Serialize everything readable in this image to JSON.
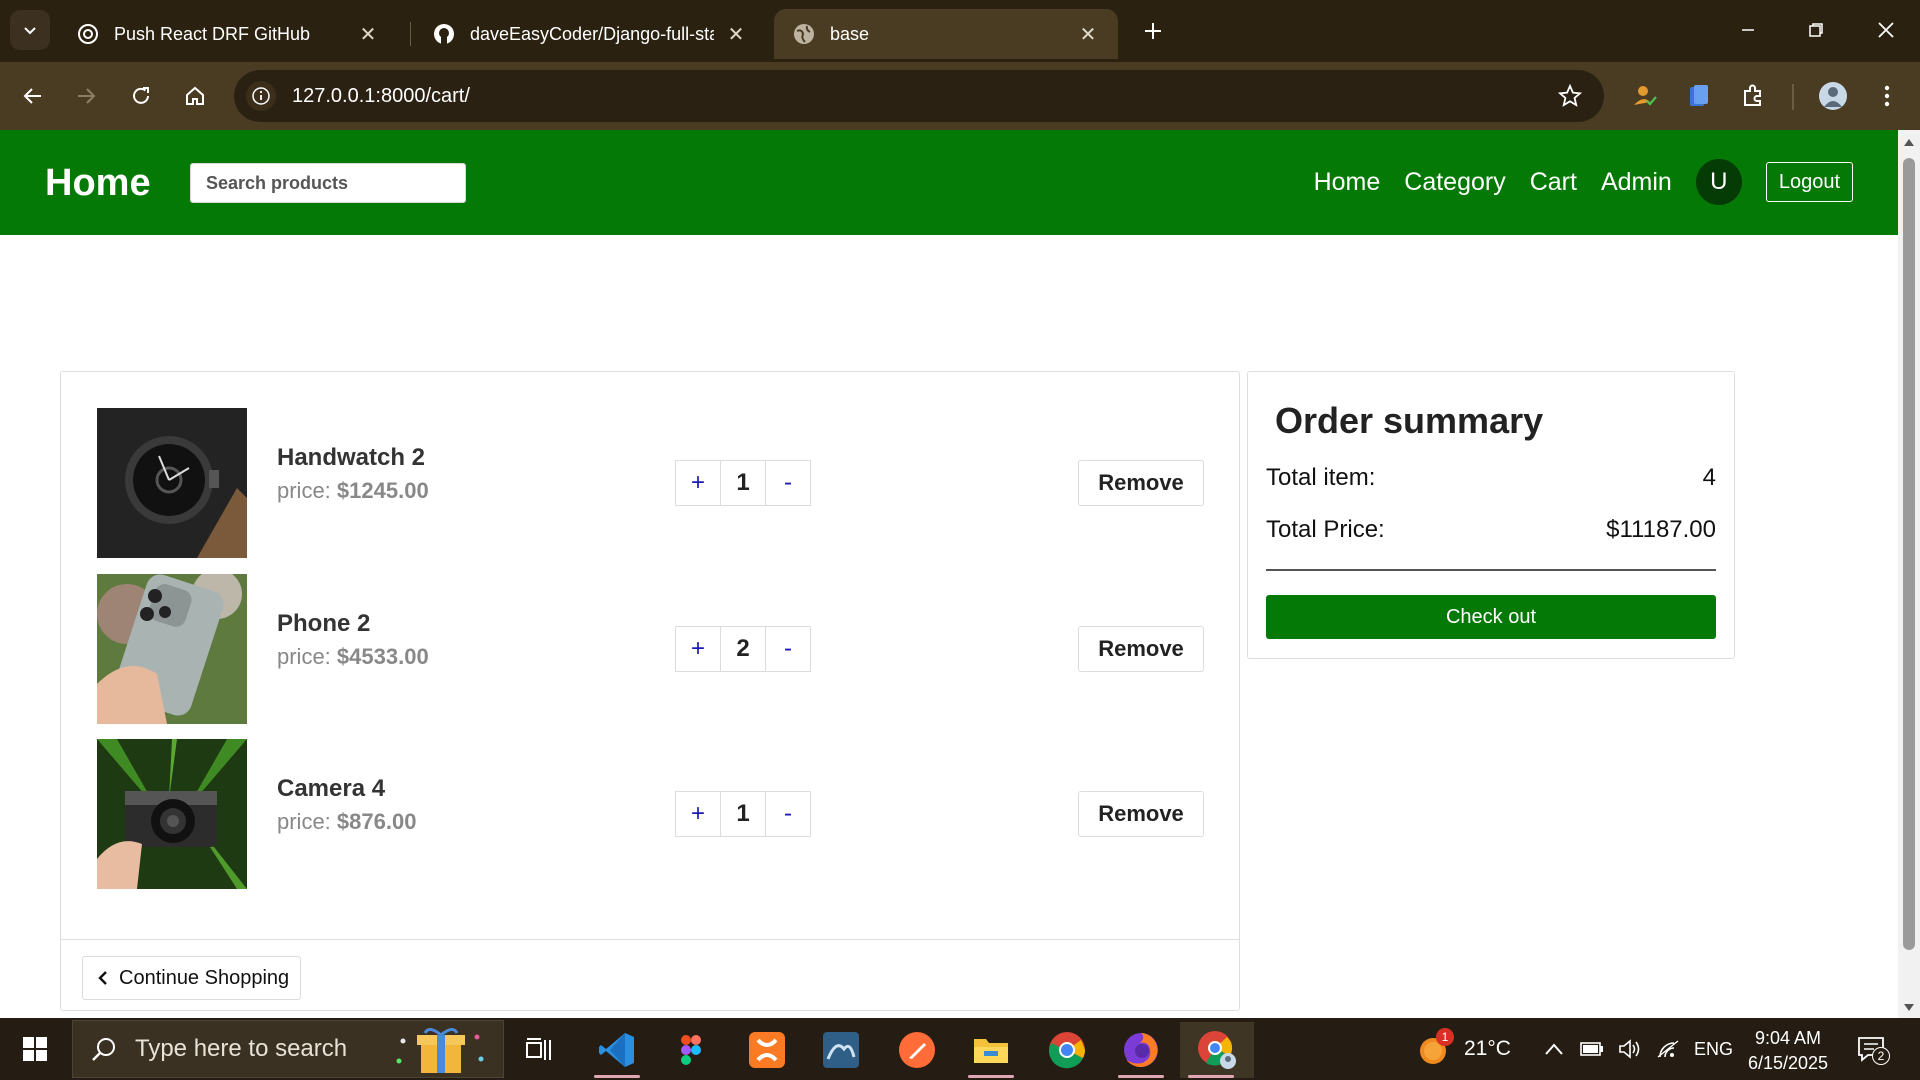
{
  "browser": {
    "tabs": [
      {
        "title": "Push React DRF GitHub",
        "icon": "openai-icon",
        "active": false
      },
      {
        "title": "daveEasyCoder/Django-full-sta",
        "icon": "github-icon",
        "active": false
      },
      {
        "title": "base",
        "icon": "globe-icon",
        "active": true
      }
    ],
    "url": "127.0.0.1:8000/cart/"
  },
  "site": {
    "brand": "Home",
    "search_placeholder": "Search products",
    "nav": [
      "Home",
      "Category",
      "Cart",
      "Admin"
    ],
    "avatar_letter": "U",
    "logout": "Logout"
  },
  "cart": {
    "items": [
      {
        "name": "Handwatch 2",
        "price_label": "price:",
        "price": "$1245.00",
        "qty": "1",
        "image": "handwatch-image"
      },
      {
        "name": "Phone 2",
        "price_label": "price:",
        "price": "$4533.00",
        "qty": "2",
        "image": "phone-image"
      },
      {
        "name": "Camera 4",
        "price_label": "price:",
        "price": "$876.00",
        "qty": "1",
        "image": "camera-image"
      }
    ],
    "plus_label": "+",
    "minus_label": "-",
    "remove_label": "Remove",
    "continue_label": "Continue Shopping"
  },
  "summary": {
    "title": "Order summary",
    "total_item_label": "Total item:",
    "total_item_value": "4",
    "total_price_label": "Total Price:",
    "total_price_value": "$11187.00",
    "checkout_label": "Check out"
  },
  "taskbar": {
    "search_text": "Type here to search",
    "weather": "21°C",
    "weather_badge": "1",
    "language": "ENG",
    "time": "9:04 AM",
    "date": "6/15/2025",
    "notifications": "2"
  },
  "colors": {
    "brand_green": "#057905",
    "chrome_bg": "#2b2110",
    "toolbar_bg": "#4a3c22"
  }
}
